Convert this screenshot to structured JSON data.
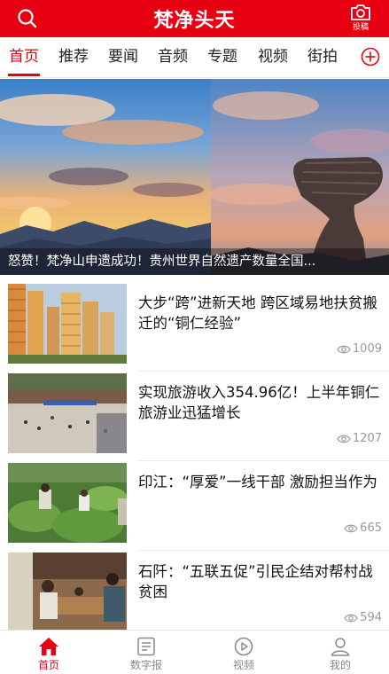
{
  "header": {
    "title": "梵净头天",
    "post_label": "投稿",
    "search_icon": "search-icon",
    "camera_icon": "camera-icon",
    "background": "#e60012"
  },
  "tabs": [
    {
      "label": "首页",
      "active": true
    },
    {
      "label": "推荐",
      "active": false
    },
    {
      "label": "要闻",
      "active": false
    },
    {
      "label": "音频",
      "active": false
    },
    {
      "label": "专题",
      "active": false
    },
    {
      "label": "视频",
      "active": false
    },
    {
      "label": "街拍",
      "active": false
    }
  ],
  "add_tab_icon": "plus-circle-icon",
  "banner": {
    "caption": "怒赞！梵净山申遗成功！贵州世界自然遗产数量全国..."
  },
  "news": [
    {
      "title": "大步“跨”进新天地 跨区域易地扶贫搬迁的“铜仁经验”",
      "views": "1009"
    },
    {
      "title": "实现旅游收入354.96亿！上半年铜仁旅游业迅猛增长",
      "views": "1207"
    },
    {
      "title": "印江：“厚爱”一线干部 激励担当作为",
      "views": "665"
    },
    {
      "title": "石阡：“五联五促”引民企结对帮村战贫困",
      "views": "594"
    }
  ],
  "bottom_nav": [
    {
      "label": "首页",
      "icon": "home-icon",
      "active": true
    },
    {
      "label": "数字报",
      "icon": "newspaper-icon",
      "active": false
    },
    {
      "label": "视频",
      "icon": "play-icon",
      "active": false
    },
    {
      "label": "我的",
      "icon": "user-icon",
      "active": false
    }
  ],
  "colors": {
    "accent": "#e60012",
    "muted": "#9a9a9a"
  }
}
